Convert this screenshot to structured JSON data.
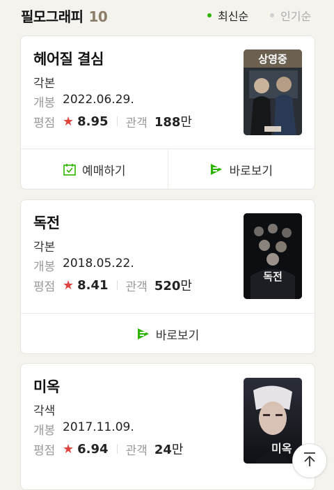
{
  "header": {
    "title": "필모그래피",
    "count": "10",
    "sort_latest": "최신순",
    "sort_popular": "인기순"
  },
  "movies": [
    {
      "title": "헤어질 결심",
      "role": "각본",
      "open_label": "개봉",
      "open_date": "2022.06.29.",
      "rating_label": "평점",
      "rating": "8.95",
      "audience_label": "관객",
      "audience": "188",
      "audience_unit": "만",
      "poster_badge": "상영중",
      "reserve_label": "예매하기",
      "watch_label": "바로보기"
    },
    {
      "title": "독전",
      "role": "각본",
      "open_label": "개봉",
      "open_date": "2018.05.22.",
      "rating_label": "평점",
      "rating": "8.41",
      "audience_label": "관객",
      "audience": "520",
      "audience_unit": "만",
      "poster_text": "독전",
      "watch_label": "바로보기"
    },
    {
      "title": "미옥",
      "role": "각색",
      "open_label": "개봉",
      "open_date": "2017.11.09.",
      "rating_label": "평점",
      "rating": "6.94",
      "audience_label": "관객",
      "audience": "24",
      "audience_unit": "만",
      "poster_text": "미옥"
    }
  ],
  "colors": {
    "accent_green": "#2db400",
    "star_red": "#e0433e",
    "count_brown": "#8c7f6a"
  }
}
